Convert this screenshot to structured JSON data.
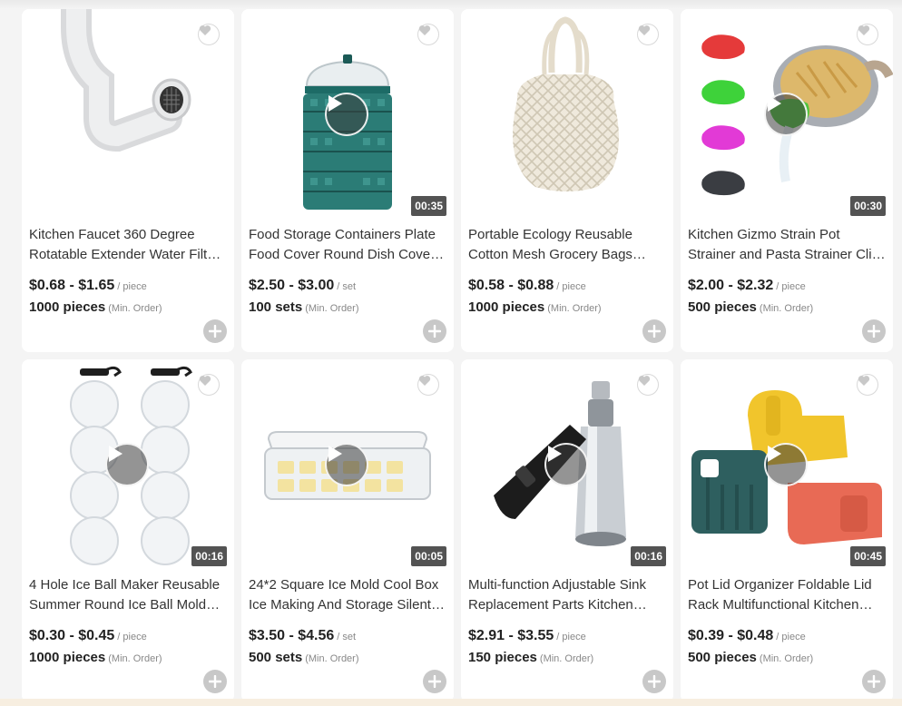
{
  "products": [
    {
      "title": "Kitchen Faucet 360 Degree Rotatable Extender Water Filter Nozzle",
      "price": "$0.68 - $1.65",
      "unit": "/ piece",
      "moq": "1000 pieces",
      "moq_label": "(Min. Order)",
      "video": false,
      "duration": ""
    },
    {
      "title": "Food Storage Containers Plate Food Cover Round Dish Cover Insulation",
      "price": "$2.50 - $3.00",
      "unit": "/ set",
      "moq": "100 sets",
      "moq_label": "(Min. Order)",
      "video": true,
      "duration": "00:35"
    },
    {
      "title": "Portable Ecology Reusable Cotton Mesh Grocery Bags Shopping Tote",
      "price": "$0.58 - $0.88",
      "unit": "/ piece",
      "moq": "1000 pieces",
      "moq_label": "(Min. Order)",
      "video": false,
      "duration": ""
    },
    {
      "title": "Kitchen Gizmo Strain Pot Strainer and Pasta Strainer Clip On Silicone",
      "price": "$2.00 - $2.32",
      "unit": "/ piece",
      "moq": "500 pieces",
      "moq_label": "(Min. Order)",
      "video": true,
      "duration": "00:30"
    },
    {
      "title": "4 Hole Ice Ball Maker Reusable Summer Round Ice Ball Mold Tray",
      "price": "$0.30 - $0.45",
      "unit": "/ piece",
      "moq": "1000 pieces",
      "moq_label": "(Min. Order)",
      "video": true,
      "duration": "00:16"
    },
    {
      "title": "24*2 Square Ice Mold Cool Box Ice Making And Storage Silent Tray",
      "price": "$3.50 - $4.56",
      "unit": "/ set",
      "moq": "500 sets",
      "moq_label": "(Min. Order)",
      "video": true,
      "duration": "00:05"
    },
    {
      "title": "Multi-function Adjustable Sink Replacement Parts Kitchen Faucet Sprayer",
      "price": "$2.91 - $3.55",
      "unit": "/ piece",
      "moq": "150 pieces",
      "moq_label": "(Min. Order)",
      "video": true,
      "duration": "00:16"
    },
    {
      "title": "Pot Lid Organizer Foldable Lid Rack Multifunctional Kitchen Holder",
      "price": "$0.39 - $0.48",
      "unit": "/ piece",
      "moq": "500 pieces",
      "moq_label": "(Min. Order)",
      "video": true,
      "duration": "00:45"
    }
  ],
  "icons": {
    "favorite": "heart-icon",
    "play": "play-icon",
    "add": "plus-icon"
  },
  "colors": {
    "page_bg": "#f4f4f4",
    "card_bg": "#ffffff",
    "icon_gray": "#c8c8c8"
  }
}
